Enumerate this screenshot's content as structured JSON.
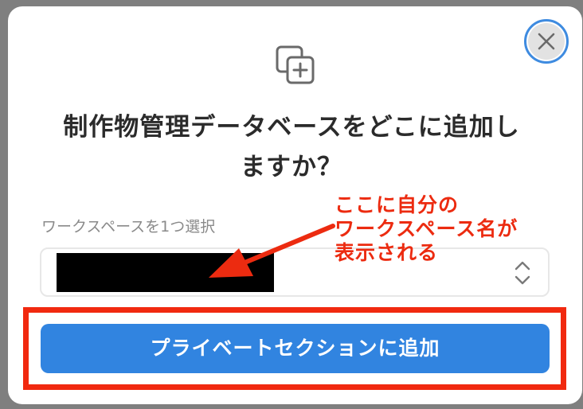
{
  "dialog": {
    "title_line1": "制作物管理データベースをどこに追加し",
    "title_line2": "ますか？",
    "icon": "duplicate-plus-icon",
    "close_icon": "close-icon"
  },
  "workspace": {
    "label": "ワークスペースを1つ選択",
    "select_icon": "chevron-up-down-icon"
  },
  "annotation": {
    "line1": "ここに自分の",
    "line2": "ワークスペース名が",
    "line3": "表示される",
    "color": "#ec2b10"
  },
  "primary_button": {
    "label": "プライベートセクションに追加",
    "color": "#3184e0"
  },
  "highlight_color": "#f1290f"
}
